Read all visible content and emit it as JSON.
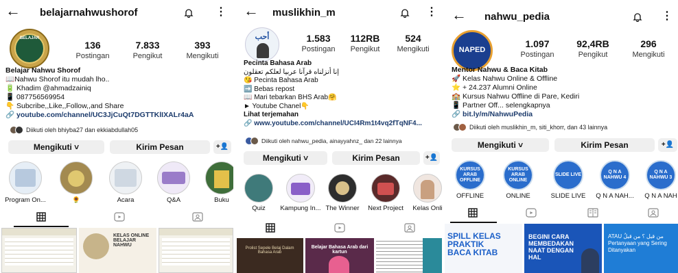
{
  "colors": {
    "link": "#1b3a6b",
    "button_bg": "#efefef"
  },
  "profiles": [
    {
      "username": "belajarnahwushorof",
      "stats": [
        {
          "value": "136",
          "label": "Postingan"
        },
        {
          "value": "7.833",
          "label": "Pengikut"
        },
        {
          "value": "393",
          "label": "Mengikuti"
        }
      ],
      "bio": [
        "Belajar Nahwu Shorof",
        "📖Nahwu Shorof itu mudah lho..",
        "🔋 Khadim @ahmadzainiq",
        "📱 087756569954",
        "👇 Subcribe,,Like,,Follow,,and Share",
        "🔗 youtube.com/channel/UC3JjCuQt7DGTTKlIXALr4aA"
      ],
      "followed_by": "Diikuti oleh bhiyba27 dan ekkiabdullah05",
      "followed_bold_1": "bhiyba27",
      "followed_bold_2": "ekkiabdullah05",
      "btn_following": "Mengikuti ˅",
      "btn_message": "Kirim Pesan",
      "avatar_text": "BELAJAR",
      "highlights": [
        "Program On...",
        "🌻",
        "Acara",
        "Q&A",
        "Buku"
      ]
    },
    {
      "username": "muslikhin_m",
      "stats": [
        {
          "value": "1.583",
          "label": "Postingan"
        },
        {
          "value": "112RB",
          "label": "Pengikut"
        },
        {
          "value": "524",
          "label": "Mengikuti"
        }
      ],
      "bio": [
        "Pecinta Bahasa Arab",
        "إنا أنزلناه قرآنا عربيا لعلكم تعقلون",
        "😘 Pecinta Bahasa Arab",
        "➡️ Bebas repost",
        "📖 Mari tebarkan BHS Arab🤗",
        "► Youtube Chanel👇",
        "Lihat terjemahan",
        "🔗 www.youtube.com/channel/UCI4Rm1t4vq2fTqNF4..."
      ],
      "followed_by": "Diikuti oleh nahwu_pedia, ainayyahnz_ dan 22 lainnya",
      "btn_following": "Mengikuti ˅",
      "btn_message": "Kirim Pesan",
      "avatar_text": "أحب",
      "highlights": [
        "Quiz",
        "Kampung In...",
        "The Winner",
        "Next Project",
        "Kelas Onli"
      ]
    },
    {
      "username": "nahwu_pedia",
      "stats": [
        {
          "value": "1.097",
          "label": "Postingan"
        },
        {
          "value": "92,4RB",
          "label": "Pengikut"
        },
        {
          "value": "296",
          "label": "Mengikuti"
        }
      ],
      "bio": [
        "Mentor Nahwu & Baca Kitab",
        "🚀 Kelas Nahwu Online & Offline",
        "⭐ + 24.237 Alumni Online",
        "🏫 Kursus Nahwu Offline di Pare, Kediri",
        "📱 Partner Off... selengkapnya",
        "🔗 bit.ly/m/NahwuPedia"
      ],
      "followed_by": "Diikuti oleh muslikhin_m, siti_khorr, dan 43 lainnya",
      "btn_following": "Mengikuti ˅",
      "btn_message": "Kirim Pesan",
      "avatar_text": "NAPED",
      "highlights": [
        "OFFLINE",
        "ONLINE",
        "SLIDE LIVE",
        "Q N A NAH...",
        "Q N A NAH"
      ],
      "highlight_inner": [
        "KURSUS ARAB OFFLINE",
        "KURSUS ARAB ONLINE",
        "SLIDE LIVE",
        "Q N A NAHWU 4",
        "Q N A NAHWU 3"
      ],
      "grid_text": [
        "SPILL KELAS PRAKTIK BACA KITAB",
        "BEGINI CARA MEMBEDAKAN NAAT DENGAN HAL",
        "ATAU من قبل ؟ من قبلُ Pertanyaan yang Sering Ditanyakan"
      ]
    }
  ],
  "grid_text_p0": [
    "KELAS ONLINE BELAJAR NAHWU"
  ],
  "grid_text_p1": [
    "Prolist Sepele Belaj Dalam Bahasa Arab",
    "Belajar Bahasa Arab dari kartun"
  ]
}
